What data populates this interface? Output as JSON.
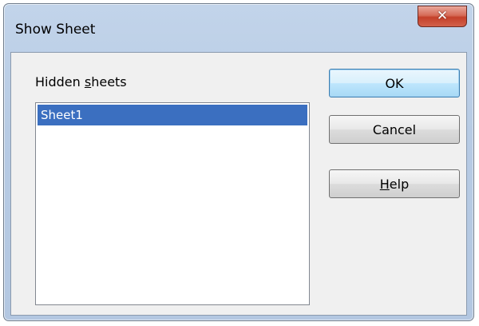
{
  "window": {
    "title": "Show Sheet",
    "close_symbol": "✕"
  },
  "dialog": {
    "hidden_sheets_label_pre": "Hidden ",
    "hidden_sheets_label_key": "s",
    "hidden_sheets_label_post": "heets",
    "sheets": [
      "Sheet1"
    ],
    "selected_index": 0
  },
  "buttons": {
    "ok": "OK",
    "cancel": "Cancel",
    "help_key": "H",
    "help_rest": "elp"
  },
  "colors": {
    "selection": "#3b6fc0",
    "close_button": "#c4402a"
  }
}
